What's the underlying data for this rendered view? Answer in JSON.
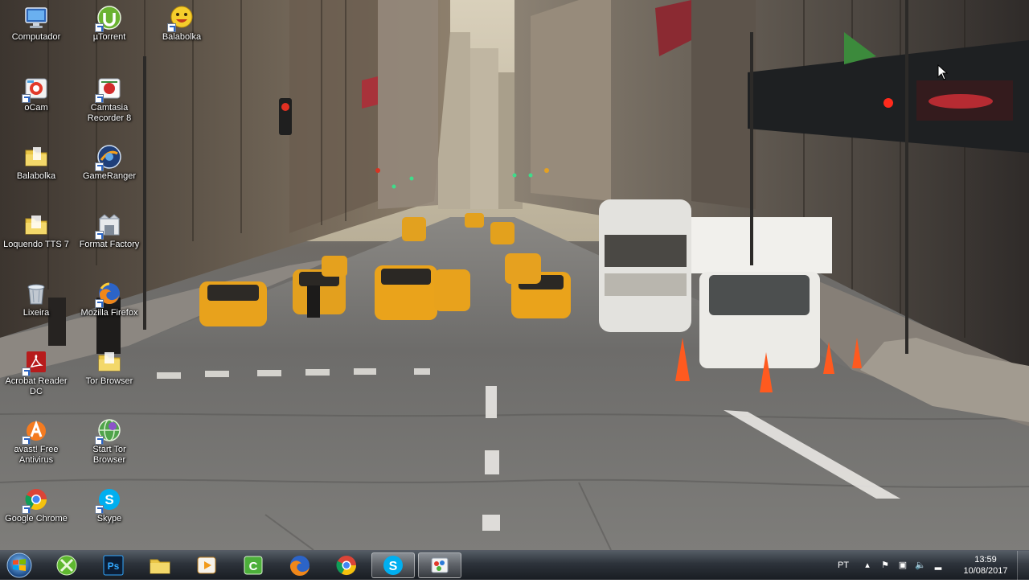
{
  "desktop": {
    "icons": [
      {
        "label": "Computador",
        "icon": "computer-icon"
      },
      {
        "label": "µTorrent",
        "icon": "utorrent-icon"
      },
      {
        "label": "Balabolka",
        "icon": "balabolka-icon"
      },
      {
        "label": "oCam",
        "icon": "ocam-icon"
      },
      {
        "label": "Camtasia Recorder 8",
        "icon": "camtasia-icon"
      },
      {
        "label": "Balabolka",
        "icon": "folder-icon"
      },
      {
        "label": "GameRanger",
        "icon": "gameranger-icon"
      },
      {
        "label": "Loquendo TTS 7",
        "icon": "folder-icon"
      },
      {
        "label": "Format Factory",
        "icon": "format-factory-icon"
      },
      {
        "label": "Lixeira",
        "icon": "recycle-bin-icon"
      },
      {
        "label": "Mozilla Firefox",
        "icon": "firefox-icon"
      },
      {
        "label": "Acrobat Reader DC",
        "icon": "acrobat-icon"
      },
      {
        "label": "Tor Browser",
        "icon": "folder-icon"
      },
      {
        "label": "avast! Free Antivirus",
        "icon": "avast-icon"
      },
      {
        "label": "Start Tor Browser",
        "icon": "tor-icon"
      },
      {
        "label": "Google Chrome",
        "icon": "chrome-icon"
      },
      {
        "label": "Skype",
        "icon": "skype-icon"
      }
    ]
  },
  "taskbar": {
    "start_icon": "windows-orb-icon",
    "pinned": [
      {
        "name": "xbox-launcher-icon",
        "active": false
      },
      {
        "name": "photoshop-icon",
        "text": "Ps",
        "active": false
      },
      {
        "name": "file-explorer-icon",
        "active": false
      },
      {
        "name": "media-player-icon",
        "active": false
      },
      {
        "name": "camtasia-taskbar-icon",
        "active": false
      },
      {
        "name": "firefox-taskbar-icon",
        "active": false
      },
      {
        "name": "chrome-taskbar-icon",
        "active": false
      },
      {
        "name": "skype-taskbar-icon",
        "active": true
      },
      {
        "name": "paint-app-icon",
        "active": true
      }
    ],
    "tray": {
      "language": "PT",
      "time": "13:59",
      "date": "10/08/2017"
    }
  },
  "colors": {
    "taxi_yellow": "#e8a21c",
    "taskbar_dark": "#1e232a",
    "sky": "#d3cab6"
  }
}
